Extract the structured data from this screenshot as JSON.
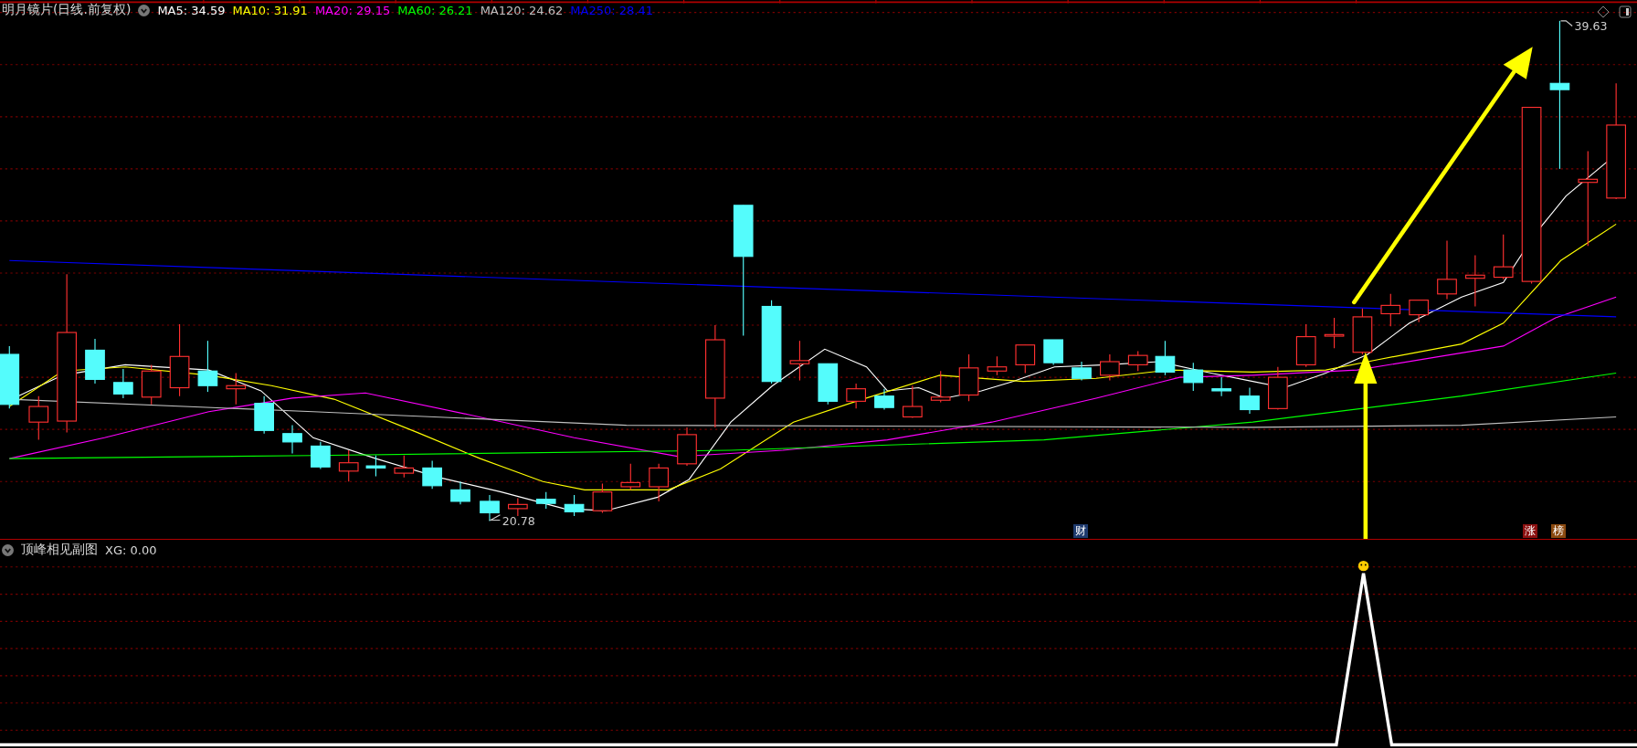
{
  "main_chart": {
    "title": "明月镜片",
    "period": "(日线.前复权)",
    "moving_averages": [
      {
        "label": "MA5: 34.59",
        "color": "#ffffff"
      },
      {
        "label": "MA10: 31.91",
        "color": "#ffff00"
      },
      {
        "label": "MA20: 29.15",
        "color": "#ff00ff"
      },
      {
        "label": "MA60: 26.21",
        "color": "#00ff00"
      },
      {
        "label": "MA120: 24.62",
        "color": "#c0c0c0"
      },
      {
        "label": "MA250: 28.41",
        "color": "#0000ff"
      }
    ],
    "high_label": "39.63",
    "low_label": "20.78",
    "event_markers": [
      {
        "label": "财",
        "color": "#1e3a6e"
      },
      {
        "label": "涨",
        "color": "#8b1010"
      },
      {
        "label": "榜",
        "color": "#8b4a10"
      }
    ]
  },
  "sub_chart": {
    "title": "顶峰相见副图",
    "indicator": "XG: 0.00"
  }
}
